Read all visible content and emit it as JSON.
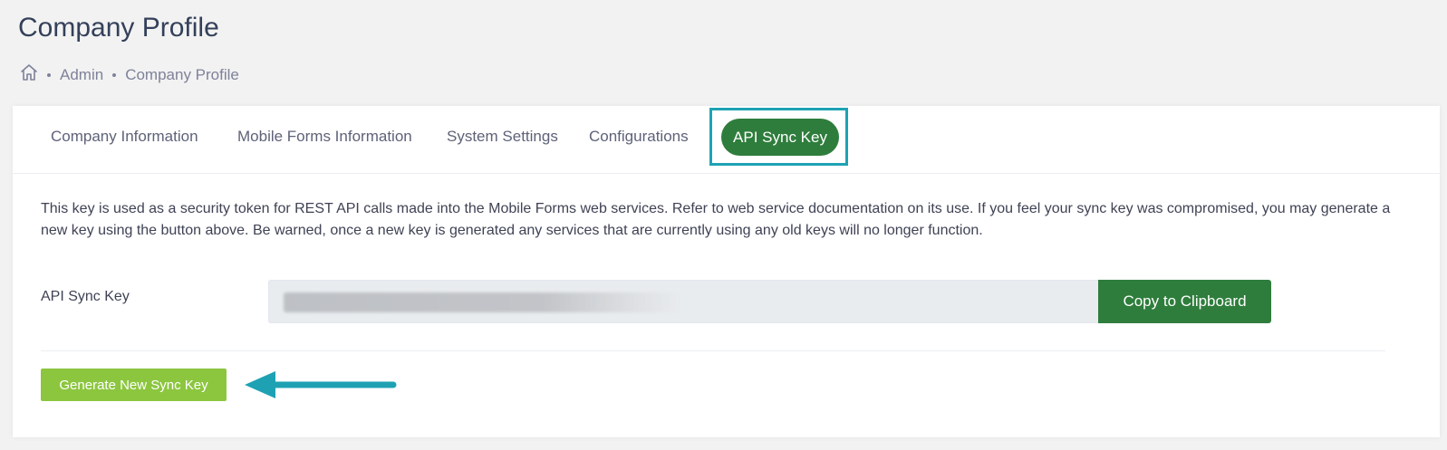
{
  "page": {
    "title": "Company Profile"
  },
  "breadcrumb": {
    "home_icon": "home-icon",
    "items": [
      "Admin",
      "Company Profile"
    ]
  },
  "tabs": [
    {
      "label": "Company Information",
      "active": false
    },
    {
      "label": "Mobile Forms Information",
      "active": false
    },
    {
      "label": "System Settings",
      "active": false
    },
    {
      "label": "Configurations",
      "active": false
    },
    {
      "label": "API Sync Key",
      "active": true
    }
  ],
  "api_sync": {
    "description": "This key is used as a security token for REST API calls made into the Mobile Forms web services. Refer to web service documentation on its use. If you feel your sync key was compromised, you may generate a new key using the button above. Be warned, once a new key is generated any services that are currently using any old keys will no longer function.",
    "field_label": "API Sync Key",
    "key_value": "",
    "copy_label": "Copy to Clipboard",
    "generate_label": "Generate New Sync Key"
  },
  "colors": {
    "primary_green": "#2e7d3c",
    "generate_green": "#8cc63f",
    "highlight_teal": "#1ea2b3",
    "background": "#f2f2f2"
  }
}
